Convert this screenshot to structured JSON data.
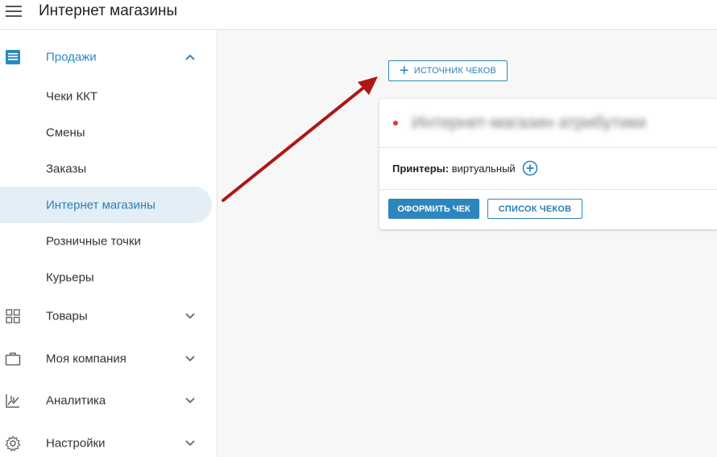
{
  "header": {
    "title": "Интернет магазины"
  },
  "sidebar": {
    "sales": {
      "label": "Продажи"
    },
    "sales_items": [
      {
        "label": "Чеки ККТ"
      },
      {
        "label": "Смены"
      },
      {
        "label": "Заказы"
      },
      {
        "label": "Интернет магазины"
      },
      {
        "label": "Розничные точки"
      },
      {
        "label": "Курьеры"
      }
    ],
    "groups": [
      {
        "label": "Товары",
        "icon": "grid-icon"
      },
      {
        "label": "Моя компания",
        "icon": "briefcase-icon"
      },
      {
        "label": "Аналитика",
        "icon": "analytics-icon"
      },
      {
        "label": "Настройки",
        "icon": "gear-icon"
      }
    ]
  },
  "main": {
    "add_source_label": "ИСТОЧНИК ЧЕКОВ",
    "shop_card": {
      "name": "Интернет-магазин атрибутики",
      "printers_label": "Принтеры:",
      "printers_value": "виртуальный",
      "issue_receipt_label": "ОФОРМИТЬ ЧЕК",
      "receipt_list_label": "СПИСОК ЧЕКОВ"
    }
  },
  "colors": {
    "accent": "#2d86bd",
    "status_dot": "#e53935",
    "annotation_arrow": "#b01515"
  }
}
